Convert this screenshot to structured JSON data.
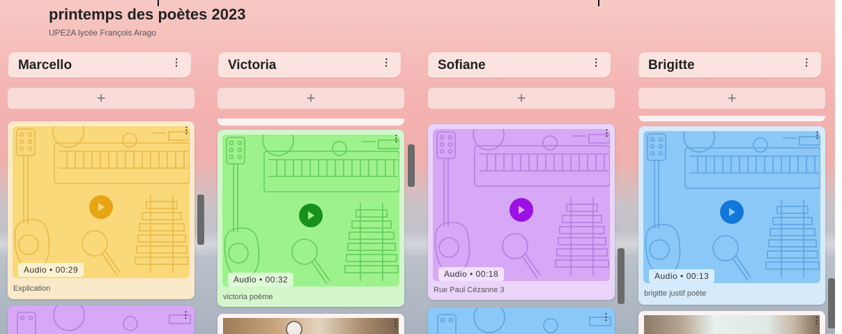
{
  "board": {
    "title": "printemps des poètes 2023",
    "subtitle": "UPE2A lycée François Arago"
  },
  "add_label": "+",
  "menu_glyph": "⋮",
  "columns": [
    {
      "name": "Marcello",
      "card": {
        "type": "Audio",
        "duration": "00:29",
        "caption": "Explication",
        "color": "#f9d97a",
        "stroke": "#e9b94a",
        "play": "#e8a414"
      }
    },
    {
      "name": "Victoria",
      "card": {
        "type": "Audio",
        "duration": "00:32",
        "caption": "victoria poème",
        "color": "#9ef28d",
        "stroke": "#65cc5a",
        "play": "#17901c"
      }
    },
    {
      "name": "Sofiane",
      "card": {
        "type": "Audio",
        "duration": "00:18",
        "caption": "Rue Paul Cézanne 3",
        "color": "#d6a8f5",
        "stroke": "#b47fe0",
        "play": "#9a10e6"
      }
    },
    {
      "name": "Brigitte",
      "card": {
        "type": "Audio",
        "duration": "00:13",
        "caption": "brigitte justif poète",
        "color": "#8cc8f7",
        "stroke": "#5ea3e0",
        "play": "#1177d9"
      }
    }
  ],
  "audio_sep": "•",
  "icons": [
    "menu-dots-icon",
    "plus-icon",
    "play-icon",
    "guitar-icon",
    "keyboard-icon",
    "microphone-icon",
    "xylophone-icon"
  ]
}
